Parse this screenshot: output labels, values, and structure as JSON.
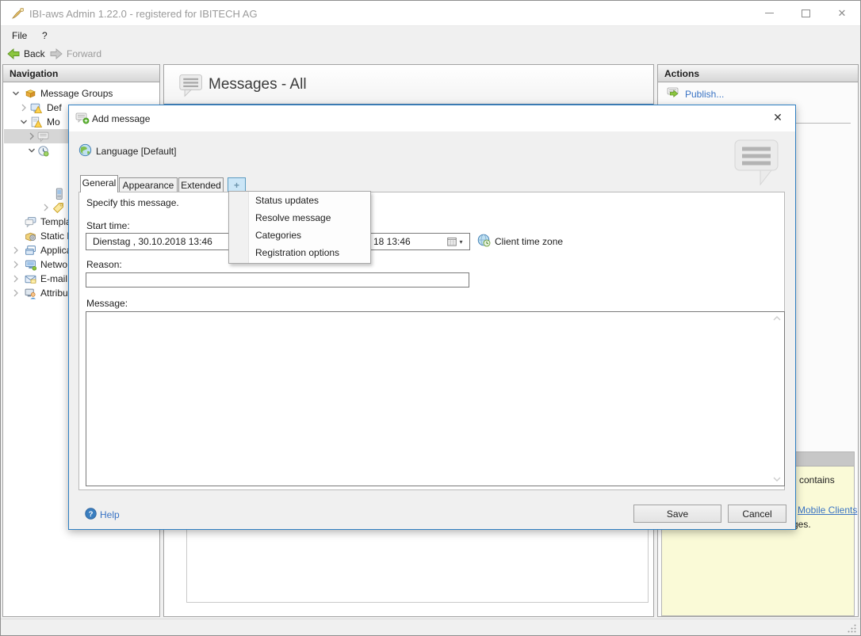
{
  "window": {
    "title": "IBI-aws Admin 1.22.0 - registered for IBITECH AG"
  },
  "icons": {
    "close_glyph": "✕",
    "dropdown_arrow": "▾"
  },
  "menu_bar": {
    "file": "File",
    "help": "?"
  },
  "toolbar": {
    "back": "Back",
    "forward": "Forward"
  },
  "navigation": {
    "header": "Navigation",
    "items": [
      {
        "label": "Message Groups"
      },
      {
        "label": "Def"
      },
      {
        "label": "Mo"
      },
      {
        "label": ""
      },
      {
        "label": ""
      },
      {
        "label": ""
      },
      {
        "label": ""
      },
      {
        "label": "Templa"
      },
      {
        "label": "Static M"
      },
      {
        "label": "Applica"
      },
      {
        "label": "Netwo"
      },
      {
        "label": "E-mail"
      },
      {
        "label": "Attribu"
      }
    ]
  },
  "main": {
    "title": "Messages - All"
  },
  "actions": {
    "header": "Actions",
    "publish": "Publish..."
  },
  "info_panel": {
    "fragment_top": "contains",
    "link": "Mobile Clients",
    "fragment_bottom": "ges."
  },
  "dialog": {
    "title": "Add message",
    "language": "Language [Default]",
    "tabs": {
      "general": "General",
      "appearance": "Appearance",
      "extended": "Extended",
      "add": "+"
    },
    "add_menu": {
      "items": [
        {
          "label": "Status updates"
        },
        {
          "label": "Resolve message"
        },
        {
          "label": "Categories"
        },
        {
          "label": "Registration options"
        }
      ]
    },
    "form": {
      "instruction": "Specify this message.",
      "start_time_label": "Start time:",
      "start_time_value": "Dienstag , 30.10.2018  13:46",
      "end_time_visible_value": "18  13:46",
      "client_time_zone_label": "Client time zone",
      "reason_label": "Reason:",
      "reason_value": "",
      "message_label": "Message:",
      "message_value": ""
    },
    "footer": {
      "help": "Help",
      "save": "Save",
      "cancel": "Cancel"
    }
  }
}
